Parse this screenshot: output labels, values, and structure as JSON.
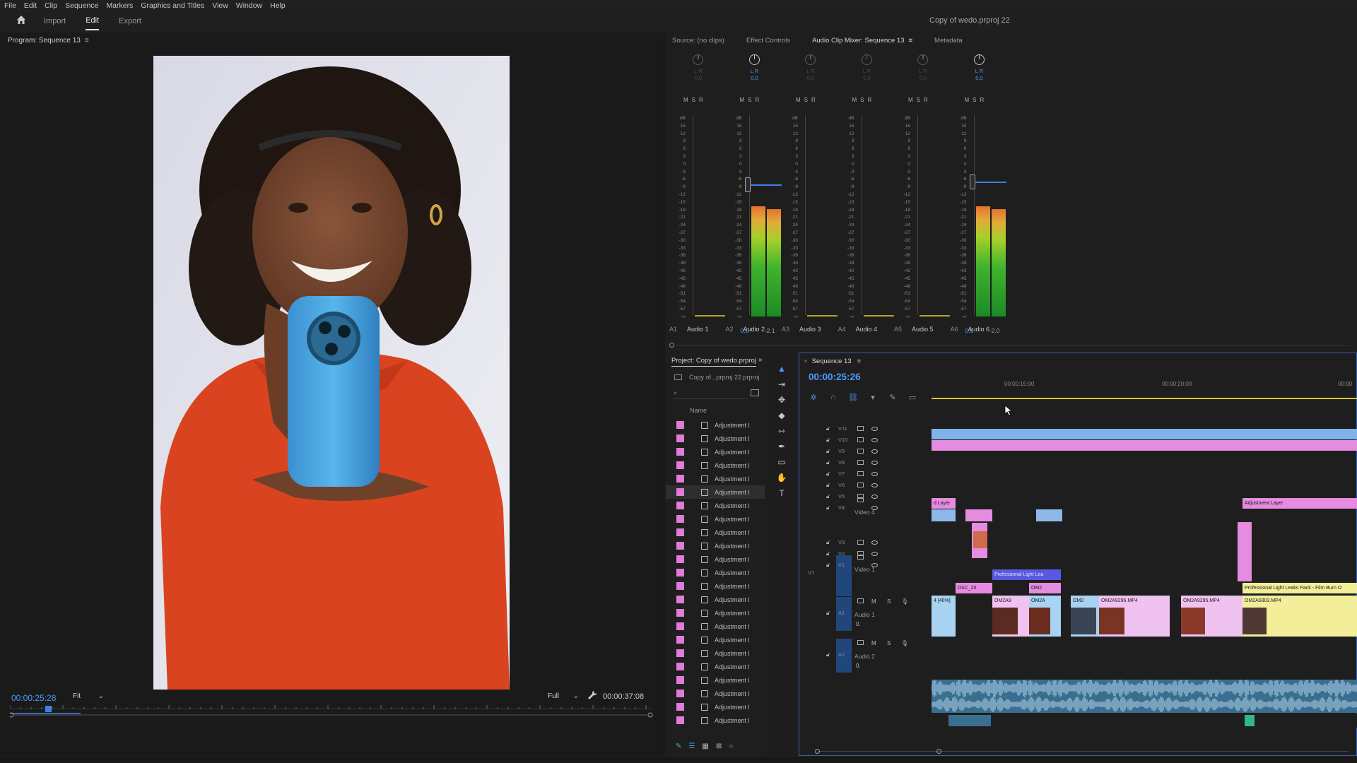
{
  "menu": [
    "File",
    "Edit",
    "Clip",
    "Sequence",
    "Markers",
    "Graphics and Titles",
    "View",
    "Window",
    "Help"
  ],
  "workspace": {
    "tabs": [
      "Import",
      "Edit",
      "Export"
    ],
    "active": "Edit",
    "project_title": "Copy of wedo.prproj 22"
  },
  "program_monitor": {
    "title": "Program: Sequence 13",
    "timecode": "00:00:25:28",
    "fit": "Fit",
    "quality": "Full",
    "duration": "00:00:37:08"
  },
  "panels": {
    "tabs": [
      "Source: (no clips)",
      "Effect Controls",
      "Audio Clip Mixer: Sequence 13",
      "Metadata"
    ],
    "active": "Audio Clip Mixer: Sequence 13"
  },
  "mixer": {
    "channels": [
      {
        "id": "A1",
        "name": "Audio 1",
        "lr": "L  R",
        "pan": "0.0",
        "live": false,
        "level": 0.0,
        "peak": 0.0,
        "readout_l": "",
        "readout_r": ""
      },
      {
        "id": "A2",
        "name": "Audio 2",
        "lr": "L  R",
        "pan": "0.0",
        "live": true,
        "level": 0.52,
        "peak": 0.55,
        "readout_l": "0.0",
        "readout_r": "-2.1"
      },
      {
        "id": "A3",
        "name": "Audio 3",
        "lr": "L  R",
        "pan": "0.0",
        "live": false,
        "level": 0.0,
        "peak": 0.0,
        "readout_l": "",
        "readout_r": ""
      },
      {
        "id": "A4",
        "name": "Audio 4",
        "lr": "L  R",
        "pan": "0.0",
        "live": false,
        "level": 0.0,
        "peak": 0.0,
        "readout_l": "",
        "readout_r": ""
      },
      {
        "id": "A5",
        "name": "Audio 5",
        "lr": "L  R",
        "pan": "0.0",
        "live": false,
        "level": 0.0,
        "peak": 0.0,
        "readout_l": "",
        "readout_r": ""
      },
      {
        "id": "A6",
        "name": "Audio 6",
        "lr": "L  R",
        "pan": "0.0",
        "live": true,
        "level": 0.54,
        "peak": 0.55,
        "readout_l": "0.0",
        "readout_r": "-2.0"
      }
    ],
    "msr": [
      "M",
      "S",
      "R"
    ],
    "scale": [
      "dB",
      "15",
      "12",
      "9",
      "6",
      "3",
      "0",
      "-3",
      "-6",
      "-9",
      "-12",
      "-15",
      "-18",
      "-21",
      "-24",
      "-27",
      "-30",
      "-33",
      "-36",
      "-39",
      "-42",
      "-45",
      "-48",
      "-51",
      "-54",
      "-57",
      "-∞"
    ]
  },
  "project": {
    "tab": "Project: Copy of wedo.prproj",
    "file": "Copy of...prproj 22.prproj",
    "column": "Name",
    "items": [
      "Adjustment l",
      "Adjustment l",
      "Adjustment l",
      "Adjustment l",
      "Adjustment l",
      "Adjustment l",
      "Adjustment l",
      "Adjustment l",
      "Adjustment l",
      "Adjustment l",
      "Adjustment l",
      "Adjustment l",
      "Adjustment l",
      "Adjustment l",
      "Adjustment l",
      "Adjustment l",
      "Adjustment l",
      "Adjustment l",
      "Adjustment l",
      "Adjustment l",
      "Adjustment l",
      "Adjustment l",
      "Adjustment l"
    ],
    "selected_index": 5
  },
  "tools": [
    "selection-tool",
    "track-select-tool",
    "ripple-edit-tool",
    "razor-tool",
    "slip-tool",
    "pen-tool",
    "rectangle-tool",
    "hand-tool",
    "type-tool"
  ],
  "timeline": {
    "tab": "Sequence 13",
    "timecode": "00:00:25:26",
    "ruler": [
      "00:00:15:00",
      "00:00:20:00",
      "00:00"
    ],
    "video_tracks": [
      "V11",
      "V10",
      "V9",
      "V8",
      "V7",
      "V6",
      "V5",
      "V4",
      "V3",
      "V2",
      "V1"
    ],
    "v4_name": "Video 4",
    "v1_name": "Video 1",
    "audio_tracks": [
      {
        "id": "A1",
        "name": "Audio 1"
      },
      {
        "id": "A2",
        "name": "Audio 2"
      }
    ],
    "source_v1": "V1",
    "clips": {
      "adj_left": "d Layer",
      "adj_right": "Adjustment Layer",
      "light_leak": "Professional Light Lea",
      "light_leak_long": "Professional Light Leaks Pack - Film Burn O",
      "dsc": "DSC_25",
      "om2": "OM2",
      "v1a": "4 [40%]",
      "v1b": "OM2A9",
      "v1c": "OM2A",
      "v1d": "OM2",
      "v1e": "OM2A9296.MP4",
      "v1f": "OM2A9295.MP4",
      "v1g": "OM2A9303.MP4"
    },
    "audio_ctl": "0."
  }
}
